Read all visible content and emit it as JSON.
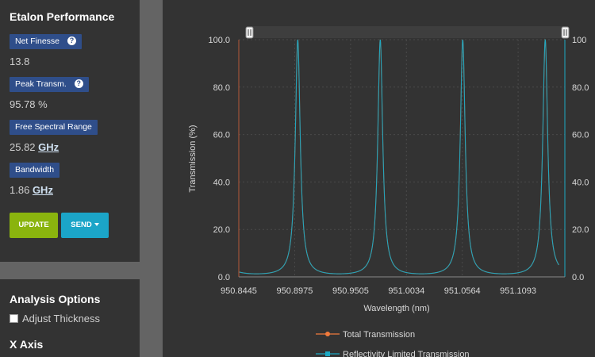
{
  "sidebar": {
    "title": "Etalon Performance",
    "metrics": [
      {
        "label": "Net Finesse",
        "value": "13.8",
        "unit": "",
        "has_help": true
      },
      {
        "label": "Peak Transm.",
        "value": "95.78 %",
        "unit": "",
        "has_help": true
      },
      {
        "label": "Free Spectral Range",
        "value": "25.82",
        "unit": "GHz",
        "has_help": false
      },
      {
        "label": "Bandwidth",
        "value": "1.86",
        "unit": "GHz",
        "has_help": false
      }
    ],
    "help_glyph": "?",
    "update_label": "UPDATE",
    "send_label": "SEND",
    "analysis_title": "Analysis Options",
    "adjust_thickness_label": "Adjust Thickness",
    "adjust_thickness_checked": false,
    "x_axis_title": "X Axis"
  },
  "colors": {
    "accent_blue": "#2f4e8a",
    "update_green": "#8ab40e",
    "send_cyan": "#1ba5c8",
    "total_transmission": "#f07a3c",
    "reflectivity_limited": "#1ca8c3"
  },
  "chart_data": {
    "type": "line",
    "xlabel": "Wavelength (nm)",
    "ylabel": "Transmission (%)",
    "x_ticks": [
      "950.8445",
      "950.8975",
      "950.9505",
      "951.0034",
      "951.0564",
      "951.1093"
    ],
    "y_ticks": [
      "0.0",
      "20.0",
      "40.0",
      "60.0",
      "80.0",
      "100.0"
    ],
    "y2_ticks": [
      "0.0",
      "20.0",
      "40.0",
      "60.0",
      "80.0",
      "100"
    ],
    "xlim": [
      950.8445,
      951.1536
    ],
    "ylim": [
      0,
      100
    ],
    "grid": true,
    "peak_wavelengths": [
      950.9004,
      950.9786,
      951.0567,
      951.1349
    ],
    "finesse": 13.8,
    "baseline": 1.3,
    "peak_value": 100,
    "series": [
      {
        "name": "Total Transmission",
        "color": "#f07a3c"
      },
      {
        "name": "Reflectivity Limited Transmission",
        "color": "#1ca8c3"
      }
    ],
    "legend_position": "bottom"
  }
}
